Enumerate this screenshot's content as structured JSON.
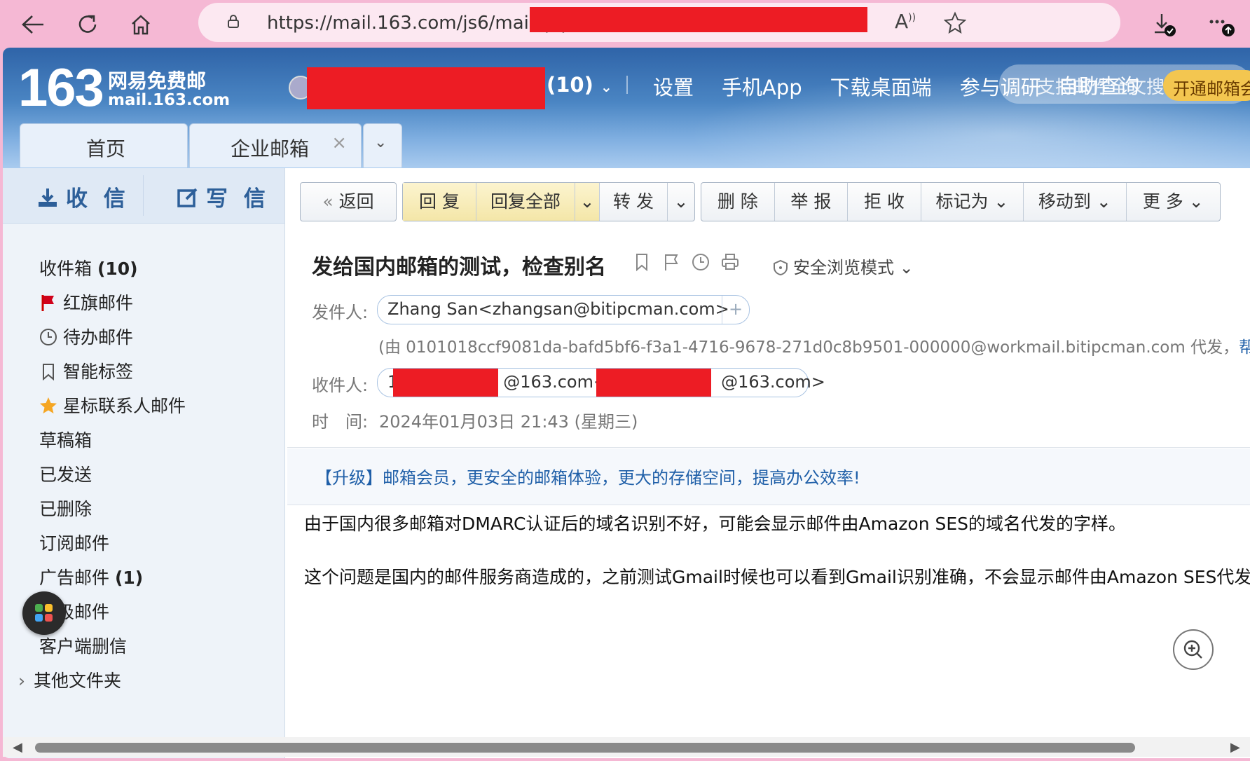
{
  "browser": {
    "url": "https://mail.163.com/js6/main.jsp?sid=",
    "icons": [
      "back-icon",
      "refresh-icon",
      "home-icon",
      "lock-icon",
      "read-aloud-icon",
      "favorite-icon",
      "downloads-icon",
      "more-icon"
    ]
  },
  "header": {
    "logo_number": "163",
    "logo_cn": "网易免费邮",
    "logo_en": "mail.163.com",
    "unread_badge": "(10)",
    "links": [
      "设置",
      "手机App",
      "下载桌面端",
      "参与调研",
      "自助查询"
    ],
    "search_placeholder": "支持邮件全文搜索",
    "open_vip_label": "开通邮箱会员"
  },
  "tabs": [
    {
      "label": "首页"
    },
    {
      "label": "企业邮箱",
      "close": "×"
    }
  ],
  "sidebar": {
    "receive_label": "收 信",
    "write_label": "写 信",
    "folders": [
      {
        "label": "收件箱",
        "count": "(10)"
      },
      {
        "label": "红旗邮件",
        "icon": "red-flag-icon"
      },
      {
        "label": "待办邮件",
        "icon": "clock-icon"
      },
      {
        "label": "智能标签",
        "icon": "bookmark-icon"
      },
      {
        "label": "星标联系人邮件",
        "icon": "star-icon"
      },
      {
        "label": "草稿箱"
      },
      {
        "label": "已发送"
      },
      {
        "label": "已删除"
      },
      {
        "label": "订阅邮件"
      },
      {
        "label": "广告邮件",
        "count": "(1)"
      },
      {
        "label": "垃圾邮件"
      },
      {
        "label": "客户端删信"
      },
      {
        "label": "其他文件夹"
      }
    ]
  },
  "toolbar": {
    "back": "返回",
    "reply": "回 复",
    "reply_all": "回复全部",
    "forward": "转 发",
    "delete": "删 除",
    "report": "举 报",
    "reject": "拒 收",
    "mark_as": "标记为",
    "move_to": "移动到",
    "more": "更 多"
  },
  "mail": {
    "subject": "发给国内邮箱的测试，检查别名",
    "safe_mode": "安全浏览模式",
    "from_label": "发件人:",
    "from_value": "Zhang San<zhangsan@bitipcman.com>",
    "proxy_text": "(由 0101018ccf9081da-bafd5bf6-f3a1-4716-9678-271d0c8b9501-000000@workmail.bitipcman.com 代发，",
    "proxy_link": "帮助",
    "to_label": "收件人:",
    "to_part1": "1",
    "to_part2": "@163.com<",
    "to_part3": "@163.com>",
    "time_label": "时　间:",
    "time_value": "2024年01月03日 21:43 (星期三)",
    "upgrade_text": "【升级】邮箱会员，更安全的邮箱体验，更大的存储空间，提高办公效率!",
    "body": [
      "由于国内很多邮箱对DMARC认证后的域名识别不好，可能会显示邮件由Amazon SES的域名代发的字样。",
      "这个问题是国内的邮件服务商造成的，之前测试Gmail时候也可以看到Gmail识别准确，不会显示邮件由Amazon SES代发的字样。"
    ]
  },
  "colors": {
    "redaction": "#ed1c24",
    "browser_frame": "#f5b8d4",
    "link_blue": "#1f5fa8"
  }
}
